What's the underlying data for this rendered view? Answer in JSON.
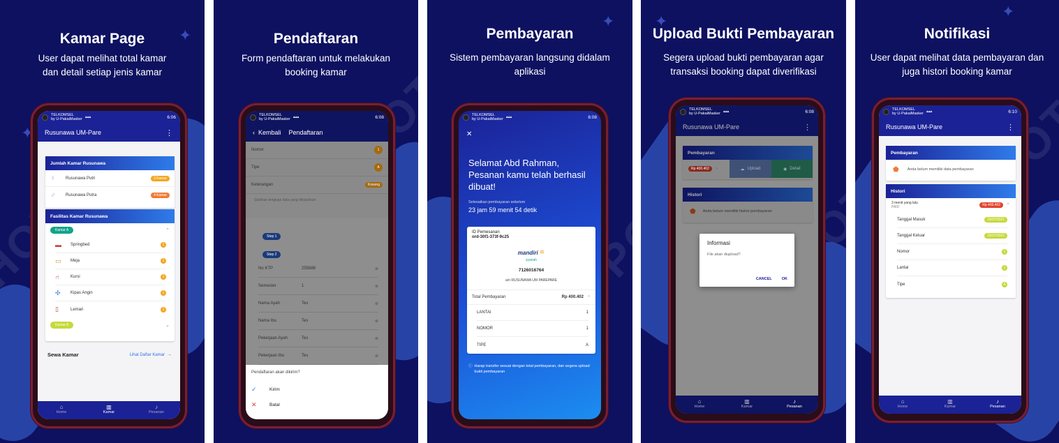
{
  "colors": {
    "bg": "#0d1160",
    "primary": "#1b2296",
    "accent_orange": "#f5a623",
    "accent_green": "#c6d93a",
    "accent_teal": "#13a38b"
  },
  "watermark": "HOTPOT",
  "panels": [
    {
      "title": "Kamar Page",
      "subtitle": "User dapat melihat total kamar dan detail setiap jenis kamar",
      "status": {
        "carrier": "TELKOMSEL",
        "carrier2": "by U-PakaiMasker",
        "time": "6:06"
      },
      "appbar_title": "Rusunawa UM-Pare",
      "jumlah_header": "Jumlah Kamar Rusunawa",
      "rooms": [
        {
          "label": "Rusunawa Putri",
          "badge": "3 Kamar"
        },
        {
          "label": "Rusunawa Putra",
          "badge": "4 Kamar"
        }
      ],
      "fasilitas_header": "Fasilitas Kamar Rusunawa",
      "kamar_a": "Kamar A",
      "facilities": [
        {
          "label": "Springbed",
          "count": "1"
        },
        {
          "label": "Meja",
          "count": "1"
        },
        {
          "label": "Kursi",
          "count": "1"
        },
        {
          "label": "Kipas Angin",
          "count": "1"
        },
        {
          "label": "Lemari",
          "count": "1"
        }
      ],
      "kamar_b": "Kamar B",
      "sewa_label": "Sewa Kamar",
      "lihat_link": "Lihat Daftar Kamar",
      "nav": [
        "Home",
        "Kamar",
        "Pesanan"
      ]
    },
    {
      "title": "Pendaftaran",
      "subtitle": "Form pendaftaran untuk melakukan booking kamar",
      "status": {
        "carrier": "TELKOMSEL",
        "carrier2": "by U-PakaiMasker",
        "time": "6:08"
      },
      "back_label": "Kembali",
      "appbar_title": "Pendaftaran",
      "summary": [
        {
          "label": "Nomor",
          "value": "1"
        },
        {
          "label": "Tipe",
          "value": "A"
        },
        {
          "label": "Keterangan",
          "value": "Kosong"
        }
      ],
      "instruction": "Silahkan lengkapi data yang dibutuhkan",
      "step1": "Step 1",
      "step2": "Step 2",
      "fields": [
        {
          "label": "No KTP",
          "value": "255888"
        },
        {
          "label": "Semester",
          "value": "1"
        },
        {
          "label": "Nama Ayah",
          "value": "Tes"
        },
        {
          "label": "Nama Ibu",
          "value": "Tes"
        },
        {
          "label": "Pekerjaan Ayah",
          "value": "Tes"
        },
        {
          "label": "Pekerjaan Ibu",
          "value": "Tes"
        }
      ],
      "sheet_title": "Pendaftaran akan dikirim?",
      "sheet_ok": "Kirim",
      "sheet_cancel": "Batal"
    },
    {
      "title": "Pembayaran",
      "subtitle": "Sistem pembayaran langsung didalam aplikasi",
      "status": {
        "carrier": "TELKOMSEL",
        "carrier2": "by U-PakaiMasker",
        "time": "6:08"
      },
      "close": "✕",
      "greeting": "Selamat Abd Rahman, Pesanan kamu telah berhasil dibuat!",
      "deadline_label": "Selesaikan pembayaran sebelum",
      "deadline": "23 jam 59 menit 54 detik",
      "order_id_label": "ID Pemesanan",
      "order_id": "ord-30f1-373f-9c25",
      "bank_name": "mandiri",
      "bank_sub": "syariah",
      "account": "7126016764",
      "account_name": "a/n RUSUNAWA UM PAREPARE",
      "total_label": "Total Pembayaran",
      "total": "Rp 400.402",
      "details": [
        {
          "label": "LANTAI",
          "value": "1"
        },
        {
          "label": "NOMOR",
          "value": "1"
        },
        {
          "label": "TIPE",
          "value": "A"
        }
      ],
      "note": "Harap transfer sesuai dengan total pembayaran, dan segera upload bukti pembayaran"
    },
    {
      "title": "Upload Bukti Pembayaran",
      "subtitle": "Segera upload bukti pembayaran agar transaksi booking dapat diverifikasi",
      "status": {
        "carrier": "TELKOMSEL",
        "carrier2": "by U-PakaiMasker",
        "time": "6:08"
      },
      "appbar_title": "Rusunawa UM-Pare",
      "pembayaran_header": "Pembayaran",
      "amount": "Rp 400.402",
      "upload": "Upload",
      "detail": "Detail",
      "histori_header": "Histori",
      "histori_empty": "Anda belum memiliki histori pembayaran",
      "dialog_title": "Informasi",
      "dialog_body": "File akan diupload?",
      "dialog_cancel": "CANCEL",
      "dialog_ok": "OK",
      "nav": [
        "Home",
        "Kamar",
        "Pesanan"
      ]
    },
    {
      "title": "Notifikasi",
      "subtitle": "User dapat melihat data pembayaran dan juga histori booking kamar",
      "status": {
        "carrier": "TELKOMSEL",
        "carrier2": "by U-PakaiMasker",
        "time": "6:10"
      },
      "appbar_title": "Rusunawa UM-Pare",
      "pembayaran_header": "Pembayaran",
      "pembayaran_empty": "Anda belum memiliki data pembayaran",
      "histori_header": "Histori",
      "histori_time": "3 menit yang lalu",
      "histori_status": "PAID",
      "histori_amount": "Rp 400.402",
      "histori_rows": [
        {
          "label": "Tanggal Masuk",
          "value": "15/07/2021"
        },
        {
          "label": "Tanggal Keluar",
          "value": "15/07/2022"
        },
        {
          "label": "Nomor",
          "value": "1"
        },
        {
          "label": "Lantai",
          "value": "1"
        },
        {
          "label": "Tipe",
          "value": "A"
        }
      ],
      "nav": [
        "Home",
        "Kamar",
        "Pesanan"
      ]
    }
  ]
}
